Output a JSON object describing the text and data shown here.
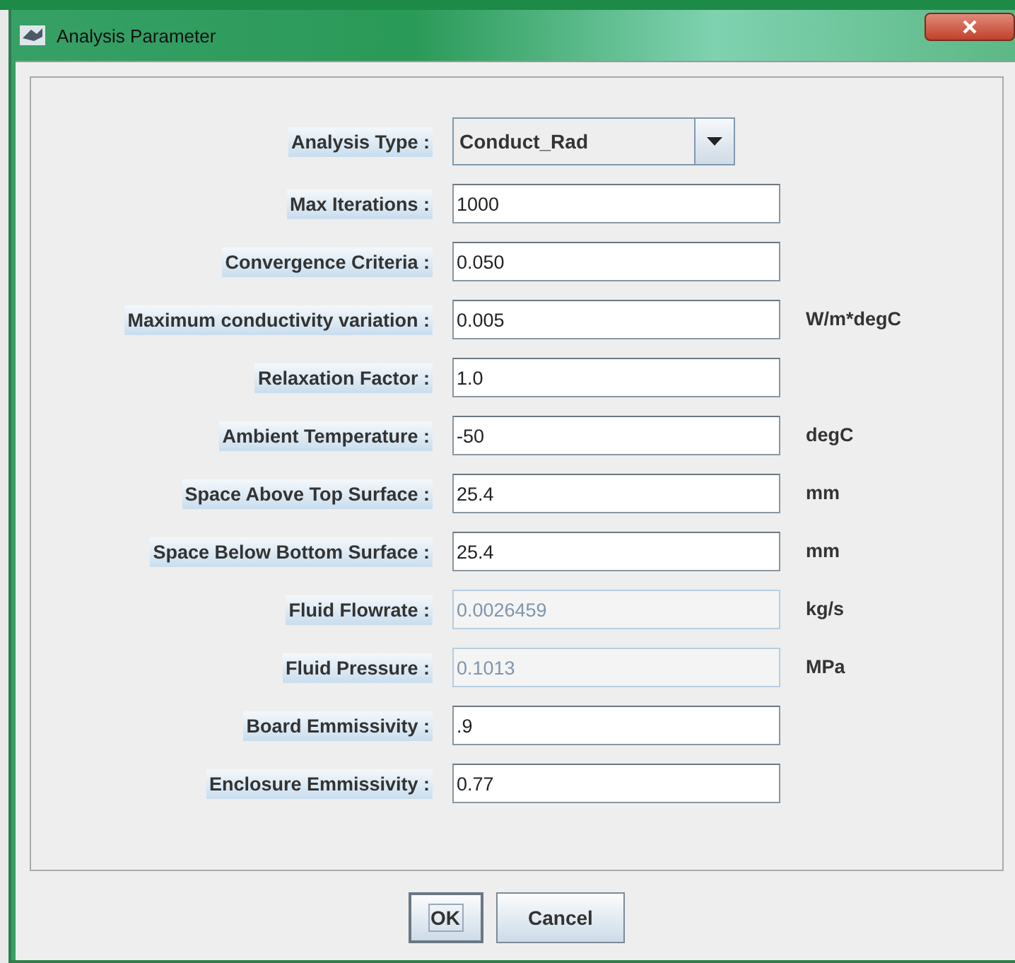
{
  "window": {
    "title": "Analysis Parameter"
  },
  "fields": [
    {
      "kind": "dropdown",
      "label": "Analysis Type :",
      "value": "Conduct_Rad",
      "disabled": false
    },
    {
      "kind": "text",
      "label": "Max Iterations :",
      "value": "1000",
      "disabled": false
    },
    {
      "kind": "text",
      "label": "Convergence Criteria :",
      "value": "0.050",
      "disabled": false
    },
    {
      "kind": "text",
      "label": "Maximum conductivity variation :",
      "value": "0.005",
      "unit": "W/m*degC",
      "disabled": false
    },
    {
      "kind": "text",
      "label": "Relaxation Factor :",
      "value": "1.0",
      "disabled": false
    },
    {
      "kind": "text",
      "label": "Ambient Temperature :",
      "value": "-50",
      "unit": "degC",
      "disabled": false
    },
    {
      "kind": "text",
      "label": "Space Above Top Surface :",
      "value": "25.4",
      "unit": "mm",
      "disabled": false
    },
    {
      "kind": "text",
      "label": "Space Below Bottom Surface :",
      "value": "25.4",
      "unit": "mm",
      "disabled": false
    },
    {
      "kind": "text",
      "label": "Fluid Flowrate :",
      "value": "0.0026459",
      "unit": "kg/s",
      "disabled": true
    },
    {
      "kind": "text",
      "label": "Fluid Pressure :",
      "value": "0.1013",
      "unit": "MPa",
      "disabled": true
    },
    {
      "kind": "text",
      "label": "Board Emmissivity :",
      "value": ".9",
      "disabled": false
    },
    {
      "kind": "text",
      "label": "Enclosure Emmissivity :",
      "value": "0.77",
      "disabled": false
    }
  ],
  "buttons": [
    {
      "label": "OK",
      "focused": true
    },
    {
      "label": "Cancel",
      "focused": false
    }
  ]
}
